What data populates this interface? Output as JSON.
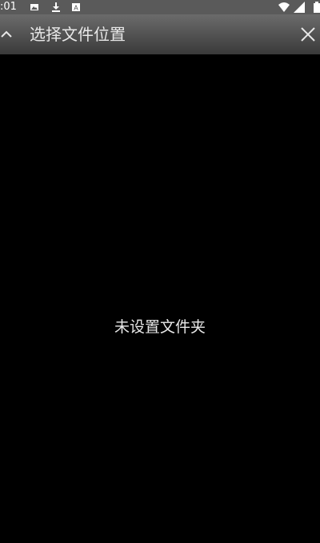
{
  "status_bar": {
    "time": ":01",
    "icons": [
      "image-icon",
      "download-icon",
      "keyboard-icon",
      "wifi-icon",
      "signal-icon",
      "battery-icon"
    ],
    "background": "#5a5a5a"
  },
  "title_bar": {
    "back_icon": "chevron-up-icon",
    "title": "选择文件位置",
    "close_icon": "close-icon"
  },
  "main": {
    "empty_message": "未设置文件夹",
    "background": "#000000"
  }
}
